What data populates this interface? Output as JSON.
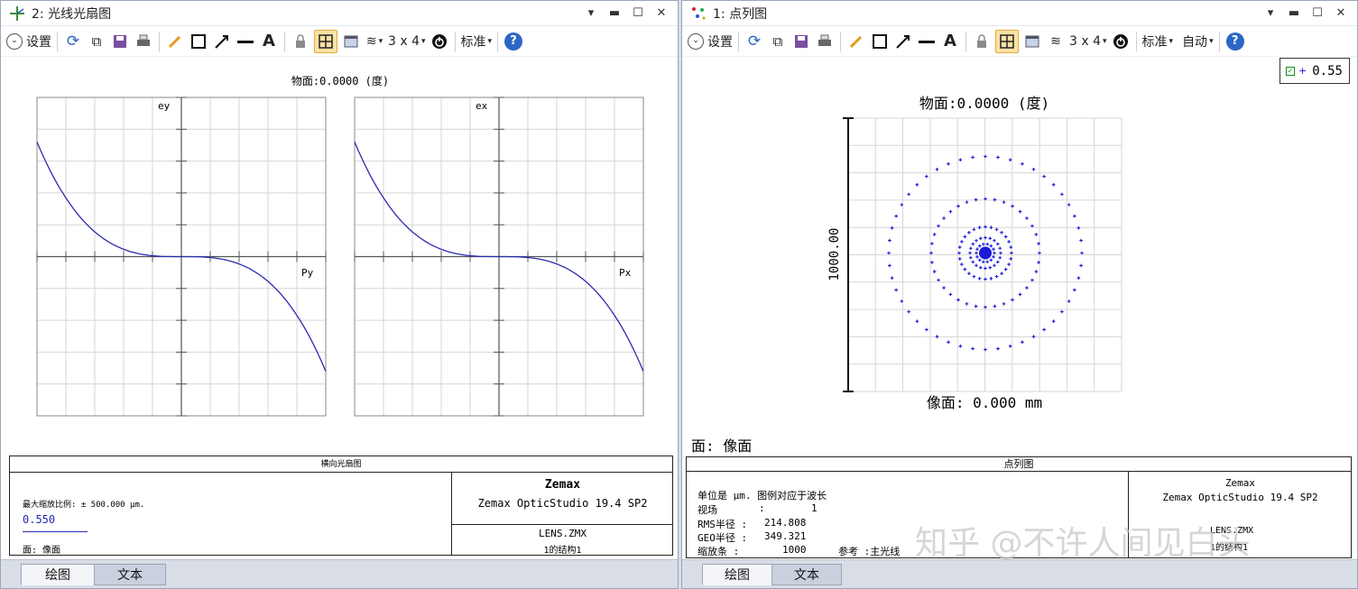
{
  "left_window": {
    "title": "2: 光线光扇图",
    "toolbar": {
      "settings_label": "设置",
      "layout_label": "3 x 4",
      "standard_label": "标准"
    },
    "plot": {
      "title": "物面:0.0000 (度)",
      "left_axis_label": "ey",
      "left_pupil_label": "Py",
      "right_axis_label": "ex",
      "right_pupil_label": "Px"
    },
    "info": {
      "header": "横向光扇图",
      "scale_text": "最大缩放比例: ± 500.000 μm.",
      "wavelength": "0.550",
      "surface": "面: 像面",
      "brand": "Zemax",
      "product": "Zemax OpticStudio 19.4 SP2",
      "file": "LENS.ZMX",
      "config": "1的结构1"
    },
    "tabs": [
      "绘图",
      "文本"
    ]
  },
  "right_window": {
    "title": "1: 点列图",
    "toolbar": {
      "settings_label": "设置",
      "layout_label": "3 x 4",
      "standard_label": "标准",
      "auto_label": "自动"
    },
    "legend_wavelength": "0.55",
    "plot": {
      "title": "物面:0.0000 (度)",
      "scale_label": "1000.00",
      "image_label": "像面: 0.000 mm",
      "surface_label": "面: 像面"
    },
    "info": {
      "header": "点列图",
      "line1": "单位是 μm. 图例对应于波长",
      "field_label": "视场",
      "field_sep": ":",
      "field_value": "1",
      "rms_label": "RMS半径 :",
      "rms_value": "214.808",
      "geo_label": "GEO半径 :",
      "geo_value": "349.321",
      "scale_label": "缩放条  :",
      "scale_value": "1000",
      "ref_label": "参考  :主光线",
      "brand": "Zemax",
      "product": "Zemax OpticStudio 19.4 SP2",
      "file": "LENS.ZMX",
      "config": "1的结构1"
    },
    "watermark": "知乎 @不许人间见白头",
    "tabs": [
      "绘图",
      "文本"
    ]
  },
  "colors": {
    "curve": "#2b2bb0",
    "spot": "#1a1ad8",
    "grid": "#d6d6d6",
    "accent": "#2c66c6"
  }
}
